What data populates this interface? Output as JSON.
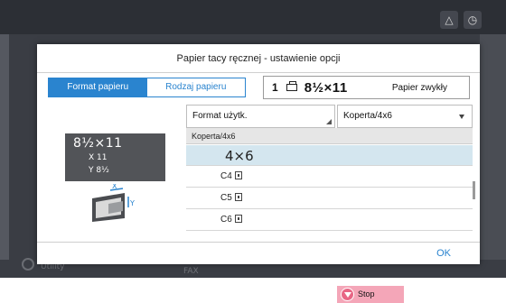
{
  "dialog": {
    "title": "Papier tacy ręcznej - ustawienie opcji",
    "tabs": [
      {
        "label": "Format papieru",
        "active": true
      },
      {
        "label": "Rodzaj papieru",
        "active": false
      }
    ],
    "summary": {
      "tray": "1",
      "size": "8½×11",
      "paper_type": "Papier zwykły"
    },
    "preview": {
      "size": "8½×11",
      "x_value": "X 11",
      "y_value": "Y 8½"
    },
    "tray_illustration": {
      "x_label": "X",
      "y_label": "Y"
    },
    "selectors": {
      "custom": "Format użytk.",
      "envelope": "Koperta/4x6"
    },
    "list": {
      "header": "Koperta/4x6",
      "items": [
        {
          "label": "4×6",
          "selected": true
        },
        {
          "label": "C4",
          "selected": false
        },
        {
          "label": "C5",
          "selected": false
        },
        {
          "label": "C6",
          "selected": false
        }
      ]
    },
    "ok_label": "OK"
  },
  "background": {
    "fax_text": "FAX",
    "utility_text": "Utility"
  },
  "stop_button": {
    "label": "Stop"
  },
  "colors": {
    "accent": "#2a84cf",
    "selected_row": "#d4e6ef",
    "stop": "#f4a6b8"
  }
}
